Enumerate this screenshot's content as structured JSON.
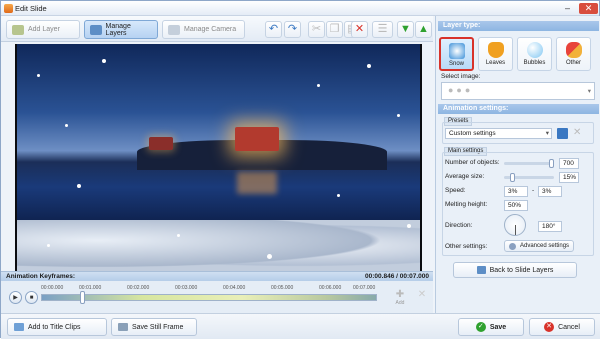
{
  "window": {
    "title": "Edit Slide"
  },
  "toolbar": {
    "add_layer": "Add Layer",
    "manage_layers": "Manage Layers",
    "manage_camera": "Manage Camera"
  },
  "timeline": {
    "header": "Animation Keyframes:",
    "time": "00:00.846 / 00:07.000",
    "ticks": [
      "00:00.000",
      "00:01.000",
      "00:02.000",
      "00:03.000",
      "00:04.000",
      "00:05.000",
      "00:06.000",
      "00:07.000"
    ],
    "add_label": "Add",
    "progress": 0.12
  },
  "bottom": {
    "add_title_clips": "Add to Title Clips",
    "save_still": "Save Still Frame",
    "save": "Save",
    "cancel": "Cancel"
  },
  "right": {
    "layer_type_header": "Layer type:",
    "layer_types": [
      {
        "label": "Snow",
        "icon": "snowflake-icon",
        "selected": true
      },
      {
        "label": "Leaves",
        "icon": "leaf-icon"
      },
      {
        "label": "Bubbles",
        "icon": "bubble-icon"
      },
      {
        "label": "Other",
        "icon": "hearts-icon"
      }
    ],
    "select_image": "Select image:",
    "animation_header": "Animation settings:",
    "presets_tab": "Presets",
    "preset_value": "Custom settings",
    "main_tab": "Main settings",
    "number_label": "Number of objects:",
    "number_value": "700",
    "size_label": "Average size:",
    "size_value": "15%",
    "speed_label": "Speed:",
    "speed_min": "3%",
    "speed_dash": "-",
    "speed_max": "3%",
    "melting_label": "Melting height:",
    "melting_value": "50%",
    "direction_label": "Direction:",
    "direction_value": "180°",
    "other_label": "Other settings:",
    "advanced": "Advanced settings",
    "back": "Back to Slide Layers"
  },
  "colors": {
    "accent": "#3f7fc9",
    "selected_border": "#d8322a",
    "save_green": "#2fa12f",
    "cancel_red": "#d8322a"
  }
}
